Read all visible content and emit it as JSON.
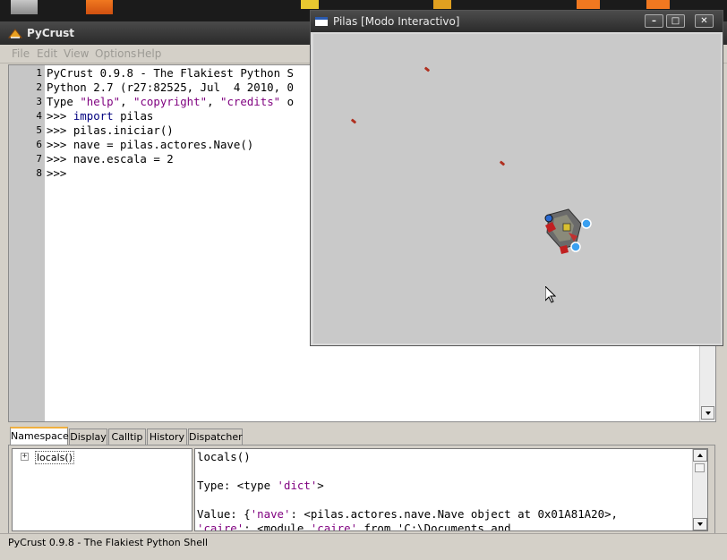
{
  "pycrust": {
    "title": "PyCrust",
    "menu": [
      "File",
      "Edit",
      "View",
      "Options",
      "Help"
    ],
    "editor": {
      "line_numbers": [
        "1",
        "2",
        "3",
        "4",
        "5",
        "6",
        "7",
        "8"
      ],
      "lines": [
        "PyCrust 0.9.8 - The Flakiest Python S",
        "Python 2.7 (r27:82525, Jul  4 2010, 0",
        "Type \"help\", \"copyright\", \"credits\" o",
        ">>> import pilas",
        ">>> pilas.iniciar()",
        ">>> nave = pilas.actores.Nave()",
        ">>> nave.escala = 2",
        ">>> "
      ]
    },
    "tabs": [
      "Namespace",
      "Display",
      "Calltip",
      "History",
      "Dispatcher"
    ],
    "active_tab": "Namespace",
    "tree": {
      "expander": "+",
      "item": "locals()"
    },
    "detail_lines": [
      "locals()",
      "",
      "Type: <type 'dict'>",
      "",
      "Value: {'nave': <pilas.actores.nave.Nave object at 0x01A81A20>,",
      "'caire': <module 'caire' from 'C:\\Documents and"
    ],
    "status": "PyCrust 0.9.8 - The Flakiest Python Shell"
  },
  "pilas": {
    "title": "Pilas [Modo Interactivo]",
    "buttons": {
      "minimize": "–",
      "maximize": "□",
      "close": "✕"
    }
  },
  "colors": {
    "keyword": "#00007f",
    "string": "#7f007f",
    "active_tab_accent": "#f0b040"
  }
}
